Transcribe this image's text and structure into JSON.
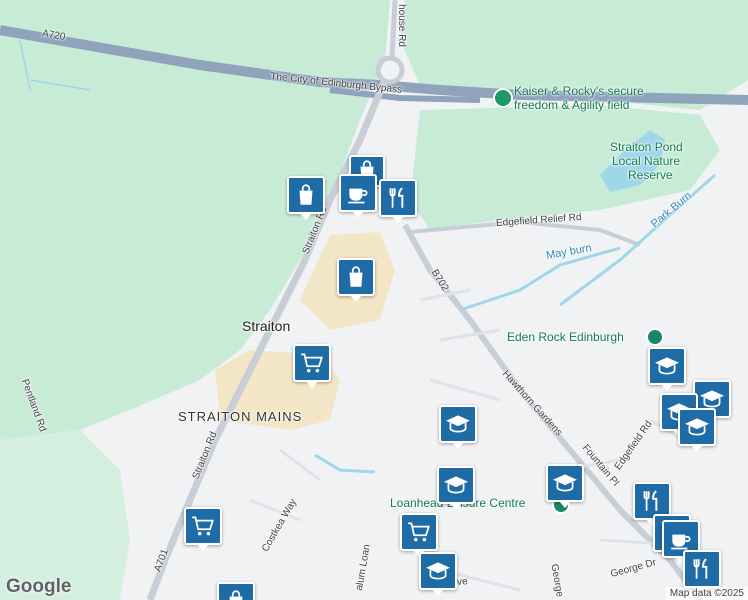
{
  "map": {
    "roads": {
      "a720": "A720",
      "bypass": "The City of Edinburgh Bypass",
      "straiton_rd_1": "Straiton Rd",
      "straiton_rd_2": "Straiton Rd",
      "house_rd": "house Rd",
      "edgefield_relief_rd": "Edgefield Relief Rd",
      "b702": "B702",
      "hawthorn_gardens": "Hawthorn Gardens",
      "fountain_pl": "Fountain Pl",
      "edgefield_rd": "Edgefield Rd",
      "pentland_rd": "Pentland Rd",
      "costkea_way": "Costkea Way",
      "a701": "A701",
      "george_dr": "George Dr",
      "parkside_ave": "Par    s Ave",
      "george_v": "George",
      "calum_loan": "alum Loan"
    },
    "places": {
      "straiton": "Straiton",
      "straiton_mains": "STRAITON MAINS",
      "kaiser_line1": "Kaiser & Rocky's secure",
      "kaiser_line2": "freedom & Agility field",
      "pond_line1": "Straiton Pond",
      "pond_line2": "Local Nature",
      "pond_line3": "Reserve",
      "eden_rock": "Eden Rock Edinburgh",
      "loanhead_leisure": "Loanhead Leisure Centre"
    },
    "water": {
      "park_burn": "Park Burn",
      "may_burn": "May burn"
    },
    "colors": {
      "park": "#c8ebd6",
      "retail": "#f3e6c7",
      "motorway": "#8fa3bd",
      "water": "#9fd7ea",
      "marker": "#1f6ba5",
      "green_label": "#0f7d4f"
    },
    "markers": [
      {
        "icon": "shopping-bag-icon",
        "name": "shop-marker-straiton-rd"
      },
      {
        "icon": "shopping-bag-icon",
        "name": "shop-marker-top"
      },
      {
        "icon": "coffee-cup-icon",
        "name": "cafe-marker-north"
      },
      {
        "icon": "restaurant-icon",
        "name": "restaurant-marker-north"
      },
      {
        "icon": "shopping-bag-icon",
        "name": "shop-marker-retail-park"
      },
      {
        "icon": "shopping-cart-icon",
        "name": "supermarket-marker-straiton"
      },
      {
        "icon": "school-icon",
        "name": "school-marker-east-1"
      },
      {
        "icon": "school-icon",
        "name": "school-marker-east-2"
      },
      {
        "icon": "school-icon",
        "name": "school-marker-east-3"
      },
      {
        "icon": "school-icon",
        "name": "school-marker-loanhead-1"
      },
      {
        "icon": "school-icon",
        "name": "school-marker-loanhead-2"
      },
      {
        "icon": "school-icon",
        "name": "school-marker-leisure"
      },
      {
        "icon": "shopping-cart-icon",
        "name": "supermarket-marker-west"
      },
      {
        "icon": "shopping-cart-icon",
        "name": "supermarket-marker-south"
      },
      {
        "icon": "school-icon",
        "name": "school-marker-south"
      },
      {
        "icon": "restaurant-icon",
        "name": "restaurant-marker-south-1"
      },
      {
        "icon": "coffee-cup-icon",
        "name": "cafe-marker-south"
      },
      {
        "icon": "restaurant-icon",
        "name": "restaurant-marker-south-2"
      },
      {
        "icon": "shopping-bag-icon",
        "name": "shop-marker-bottom"
      }
    ],
    "logo": "Google",
    "attribution": "Map data ©2025"
  }
}
